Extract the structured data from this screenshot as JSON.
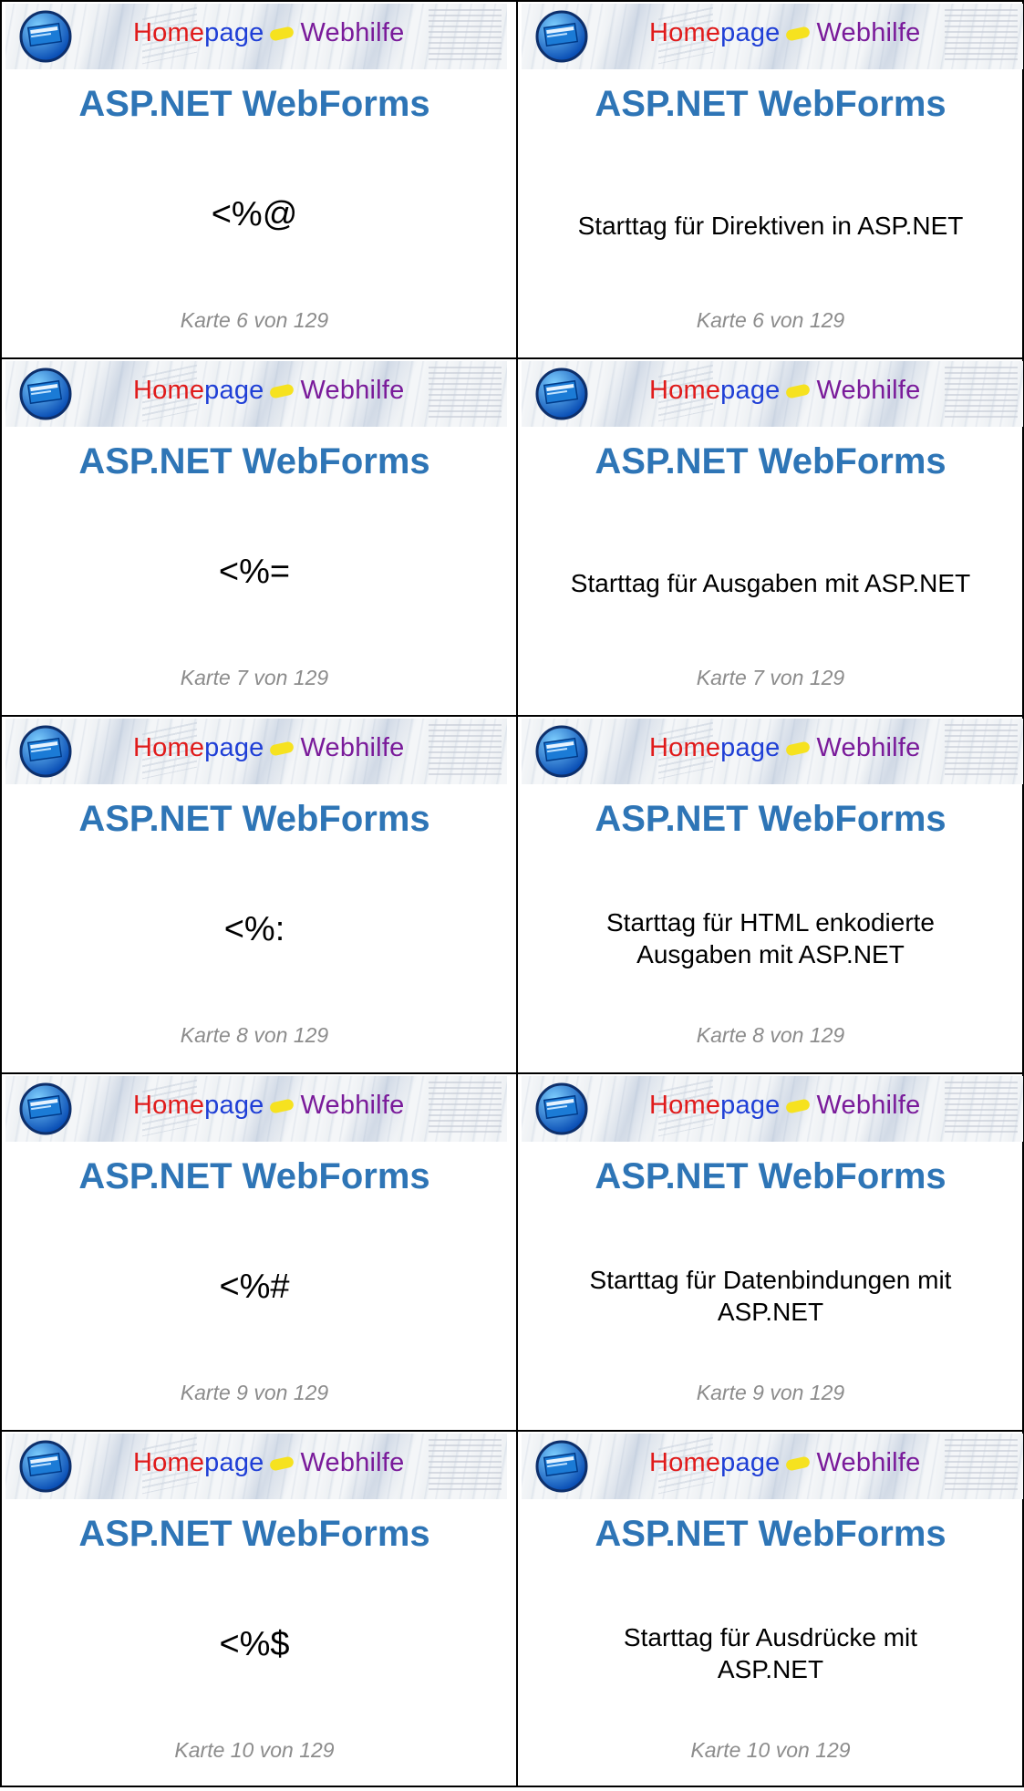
{
  "banner": {
    "brand_home": "Home",
    "brand_page": "page",
    "brand_web": "Webhilfe",
    "globe_icon": "globe-icon"
  },
  "cards": [
    {
      "title": "ASP.NET WebForms",
      "front": "<%@",
      "back": "Starttag für Direktiven in ASP.NET",
      "footer": "Karte 6 von 129"
    },
    {
      "title": "ASP.NET WebForms",
      "front": "<%=",
      "back": "Starttag für Ausgaben mit ASP.NET",
      "footer": "Karte 7 von 129"
    },
    {
      "title": "ASP.NET WebForms",
      "front": "<%:",
      "back_line1": "Starttag für HTML enkodierte",
      "back_line2": "Ausgaben mit ASP.NET",
      "footer": "Karte 8 von 129"
    },
    {
      "title": "ASP.NET WebForms",
      "front": "<%#",
      "back_line1": "Starttag für Datenbindungen mit",
      "back_line2": "ASP.NET",
      "footer": "Karte 9 von 129"
    },
    {
      "title": "ASP.NET WebForms",
      "front": "<%$",
      "back_line1": "Starttag für Ausdrücke mit",
      "back_line2": "ASP.NET",
      "footer": "Karte 10 von 129"
    }
  ],
  "colors": {
    "title": "#2e75b6",
    "footer": "#8c8c8c",
    "brand_home": "#e01b1b",
    "brand_page": "#1f3fd6",
    "brand_web": "#7a1b9a"
  }
}
